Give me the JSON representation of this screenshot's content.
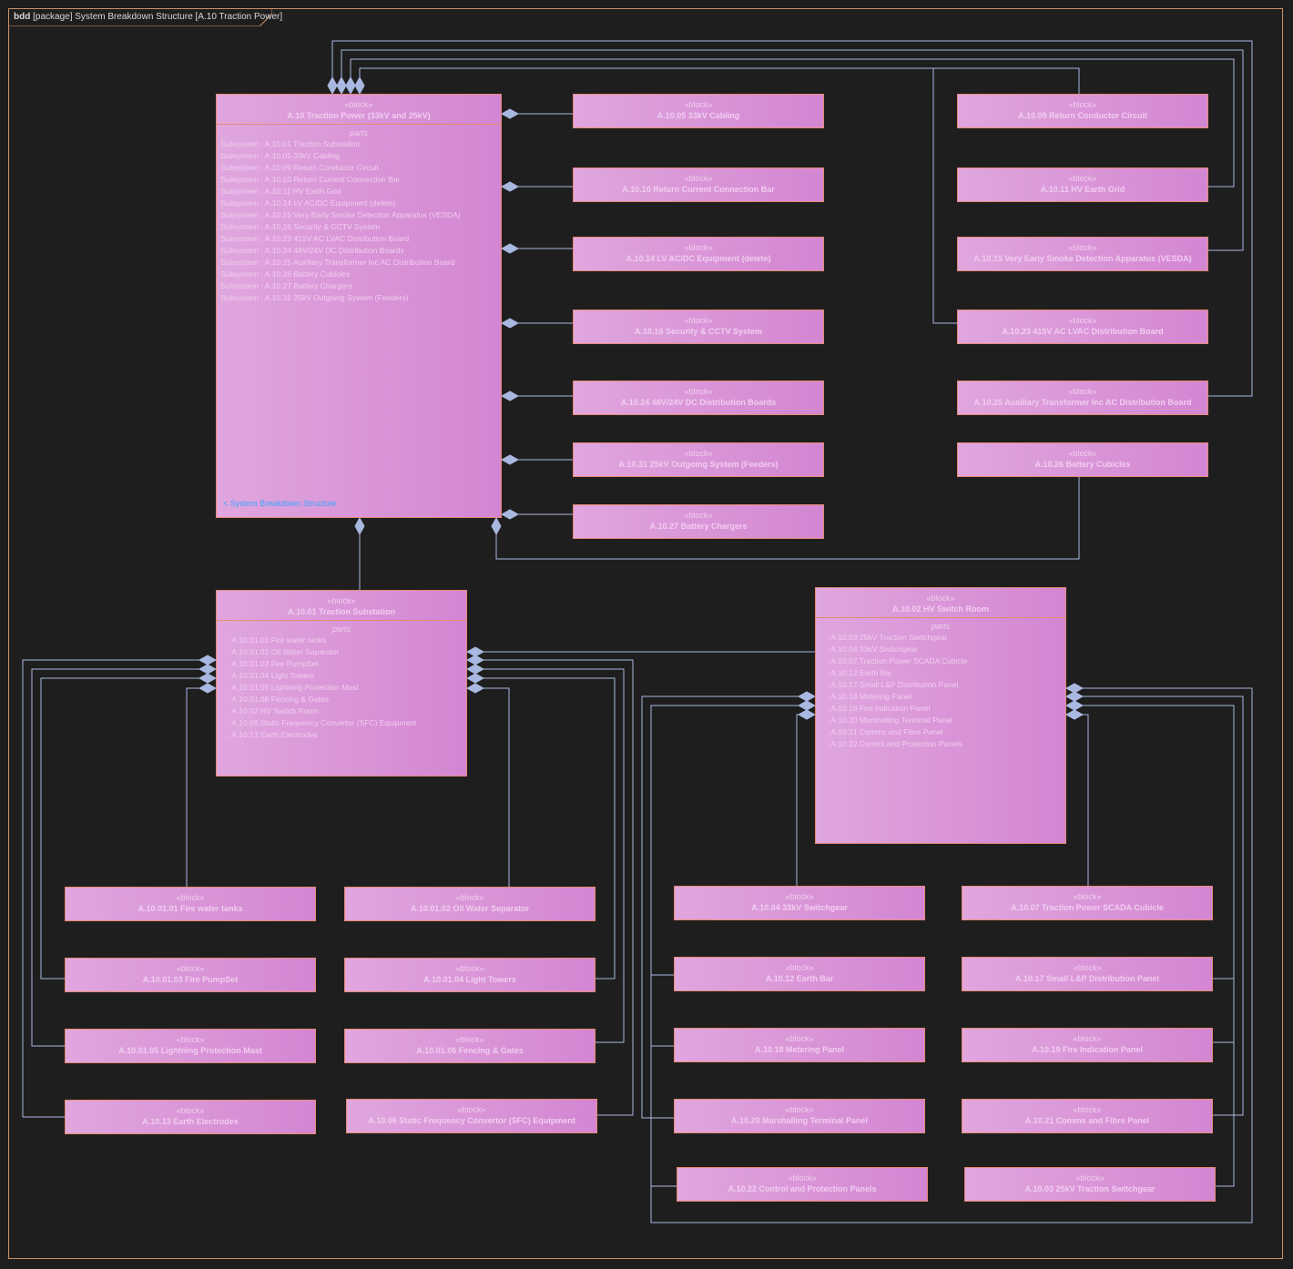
{
  "frame": {
    "kind": "bdd",
    "title": "[package] System Breakdown Structure [A.10 Traction Power]"
  },
  "colors": {
    "background": "#1e1e1e",
    "block_fill_left": "#e0a6de",
    "block_fill_right": "#d386d2",
    "block_border": "#e58a72",
    "connector": "#a9b8e0",
    "link": "#3aa6ff"
  },
  "stereotype": "«block»",
  "parts_label": "parts",
  "main": {
    "name": "A.10 Traction Power (33kV and 25kV)",
    "parts": [
      "Subsystem : A.10.01 Traction Substation",
      "Subsystem : A.10.05 33kV Cabling",
      "Subsystem : A.10.09 Return Conductor Circuit",
      "Subsystem : A.10.10 Return Current Connection Bar",
      "Subsystem : A.10.11 HV Earth Grid",
      "Subsystem : A.10.14 LV AC/DC Equipment (delete)",
      "Subsystem : A.10.15 Very Early Smoke Detection Apparatus (VESDA)",
      "Subsystem : A.10.16 Security & CCTV System",
      "Subsystem : A.10.23 415V AC LVAC Distribution Board",
      "Subsystem : A.10.24 48V/24V DC Distribution Boards",
      "Subsystem : A.10.25 Auxiliary Transformer Inc AC Distribution Board",
      "Subsystem : A.10.26 Battery Cubicles",
      "Subsystem : A.10.27 Battery Chargers",
      "Subsystem : A.10.31 25kV Outgoing System (Feeders)"
    ],
    "link": "< System Breakdown Structure"
  },
  "substation": {
    "name": "A.10.01 Traction Substation",
    "parts": [
      ": A.10.01.01 Fire water tanks",
      ": A.10.01.02 Oil Water Separator",
      ": A.10.01.03 Fire PumpSet",
      ": A.10.01.04 Light Towers",
      ": A.10.01.05 Lightning Protection Mast",
      ": A.10.01.06 Fencing & Gates",
      ": A.10.02 HV Switch Room",
      ": A.10.06 Static Frequency Convertor (SFC) Equipment",
      ": A.10.13 Earth Electrodes"
    ]
  },
  "switchroom": {
    "name": "A.10.02 HV Switch Room",
    "parts": [
      ": A.10.03 25kV Traction Switchgear",
      ": A.10.04 33kV Switchgear",
      ": A.10.07 Traction Power SCADA Cubicle",
      ": A.10.12 Earth Bar",
      ": A.10.17 Small L&P Distribution Panel",
      ": A.10.18 Metering Panel",
      ": A.10.19 Fire Indication Panel",
      ": A.10.20 Marshalling Terminal Panel",
      ": A.10.21 Comms and Fibre Panel",
      ": A.10.22 Control and Protection Panels"
    ]
  },
  "blocks": {
    "b1005": "A.10.05 33kV Cabling",
    "b1010": "A.10.10 Return Current Connection Bar",
    "b1014": "A.10.14 LV AC/DC Equipment (delete)",
    "b1016": "A.10.16 Security & CCTV System",
    "b1024": "A.10.24 48V/24V DC Distribution Boards",
    "b1031": "A.10.31 25kV Outgoing System (Feeders)",
    "b1027": "A.10.27 Battery Chargers",
    "b1009": "A.10.09 Return Conductor Circuit",
    "b1011": "A.10.11 HV Earth Grid",
    "b1015": "A.10.15 Very Early Smoke Detection Apparatus (VESDA)",
    "b1023": "A.10.23 415V AC LVAC Distribution Board",
    "b1025": "A.10.25 Auxiliary Transformer Inc AC Distribution Board",
    "b1026": "A.10.26 Battery Cubicles",
    "b101001": "A.10.01.01 Fire water tanks",
    "b101002": "A.10.01.02 Oil Water Separator",
    "b101003": "A.10.01.03 Fire PumpSet",
    "b101004": "A.10.01.04 Light Towers",
    "b101005": "A.10.01.05 Lightning Protection Mast",
    "b101006": "A.10.01.06 Fencing & Gates",
    "b1013": "A.10.13 Earth Electrodes",
    "b1006": "A.10.06 Static Frequency Convertor (SFC) Equipment",
    "b1004": "A.10.04 33kV Switchgear",
    "b1007": "A.10.07 Traction Power SCADA Cubicle",
    "b1012": "A.10.12 Earth Bar",
    "b1017": "A.10.17 Small L&P Distribution Panel",
    "b1018": "A.10.18 Metering Panel",
    "b1019": "A.10.19 Fire Indication Panel",
    "b1020": "A.10.20 Marshalling Terminal Panel",
    "b1021": "A.10.21 Comms and Fibre Panel",
    "b1022": "A.10.22 Control and Protection Panels",
    "b1003": "A.10.03 25kV Traction Switchgear"
  }
}
